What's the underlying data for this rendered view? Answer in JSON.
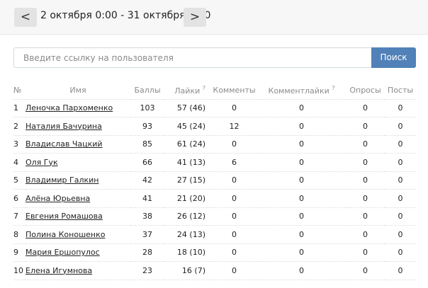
{
  "period": {
    "prev_label": "<",
    "range": "2 октября 0:00 - 31 октября 0:00",
    "next_label": ">"
  },
  "search": {
    "placeholder": "Введите ссылку на пользователя",
    "button_label": "Поиск"
  },
  "table": {
    "headers": {
      "no": "№",
      "name": "Имя",
      "score": "Баллы",
      "likes": "Лайки",
      "comments": "Комменты",
      "comment_likes": "Комментлайки",
      "polls": "Опросы",
      "posts": "Посты",
      "hint_mark": "?"
    },
    "rows": [
      {
        "no": "1",
        "name": "Леночка Пархоменко",
        "score": "103",
        "likes": "57 (46)",
        "comments": "0",
        "comment_likes": "0",
        "polls": "0",
        "posts": "0"
      },
      {
        "no": "2",
        "name": "Наталия Бачурина",
        "score": "93",
        "likes": "45 (24)",
        "comments": "12",
        "comment_likes": "0",
        "polls": "0",
        "posts": "0"
      },
      {
        "no": "3",
        "name": "Владислав Чацкий",
        "score": "85",
        "likes": "61 (24)",
        "comments": "0",
        "comment_likes": "0",
        "polls": "0",
        "posts": "0"
      },
      {
        "no": "4",
        "name": "Оля Гук",
        "score": "66",
        "likes": "41 (13)",
        "comments": "6",
        "comment_likes": "0",
        "polls": "0",
        "posts": "0"
      },
      {
        "no": "5",
        "name": "Владимир Галкин",
        "score": "42",
        "likes": "27 (15)",
        "comments": "0",
        "comment_likes": "0",
        "polls": "0",
        "posts": "0"
      },
      {
        "no": "6",
        "name": "Алёна Юрьевна",
        "score": "41",
        "likes": "21 (20)",
        "comments": "0",
        "comment_likes": "0",
        "polls": "0",
        "posts": "0"
      },
      {
        "no": "7",
        "name": "Евгения Ромашова",
        "score": "38",
        "likes": "26 (12)",
        "comments": "0",
        "comment_likes": "0",
        "polls": "0",
        "posts": "0"
      },
      {
        "no": "8",
        "name": "Полина Коношенко",
        "score": "37",
        "likes": "24 (13)",
        "comments": "0",
        "comment_likes": "0",
        "polls": "0",
        "posts": "0"
      },
      {
        "no": "9",
        "name": "Мария Ершопулос",
        "score": "28",
        "likes": "18 (10)",
        "comments": "0",
        "comment_likes": "0",
        "polls": "0",
        "posts": "0"
      },
      {
        "no": "10",
        "name": "Елена Игумнова",
        "score": "23",
        "likes": "16 (7)",
        "comments": "0",
        "comment_likes": "0",
        "polls": "0",
        "posts": "0"
      }
    ]
  }
}
